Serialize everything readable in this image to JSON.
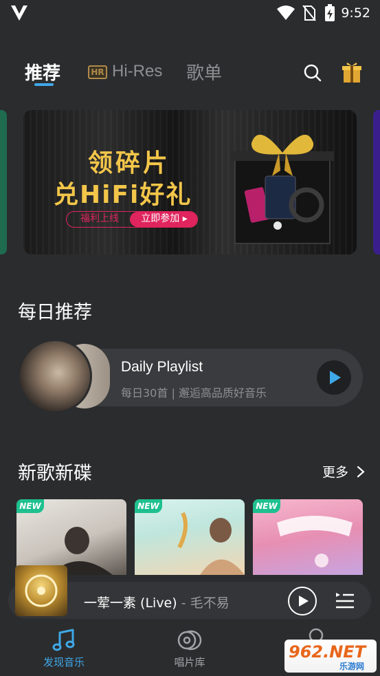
{
  "status_bar": {
    "time": "9:52"
  },
  "tabs": [
    {
      "label": "推荐",
      "active": true
    },
    {
      "label": "Hi-Res",
      "badge": "HR"
    },
    {
      "label": "歌单"
    }
  ],
  "banner": {
    "title_line1": "领碎片",
    "title_line2": "兑HiFi好礼",
    "pill_left": "福利上线",
    "pill_right": "立即参加 ▸"
  },
  "daily": {
    "section_title": "每日推荐",
    "playlist_title": "Daily Playlist",
    "playlist_subtitle": "每日30首 | 邂逅高品质好音乐"
  },
  "new_releases": {
    "section_title": "新歌新碟",
    "more_label": "更多",
    "albums": [
      {
        "tag": "NEW"
      },
      {
        "tag": "NEW"
      },
      {
        "tag": "NEW"
      }
    ]
  },
  "mini_player": {
    "song": "一荤一素 (Live)",
    "separator": " - ",
    "artist": "毛不易"
  },
  "bottom_nav": [
    {
      "label": "发现音乐",
      "active": true,
      "icon": "music-note-icon"
    },
    {
      "label": "唱片库",
      "active": false,
      "icon": "vinyl-icon"
    },
    {
      "label": "",
      "active": false,
      "icon": "profile-icon"
    }
  ],
  "watermark": {
    "text": "962.NET",
    "sub": "乐游网"
  },
  "colors": {
    "background": "#2b2c2e",
    "accent": "#3fa8e8",
    "gold": "#f3c64a",
    "pink": "#e0245e",
    "new_tag": "#1fc08f"
  }
}
